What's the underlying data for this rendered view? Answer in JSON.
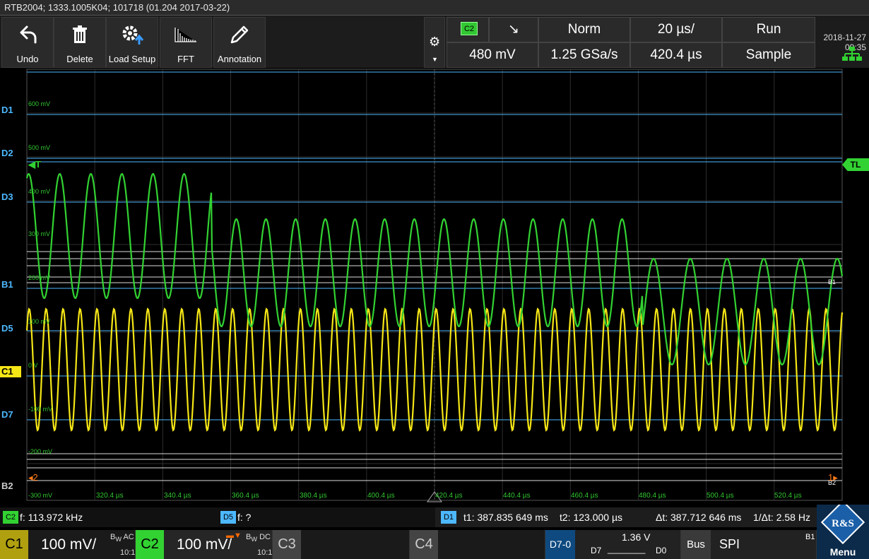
{
  "window": {
    "title": "RTB2004; 1333.1005K04; 101718 (01.204 2017-03-22)"
  },
  "toolbar": {
    "undo": "Undo",
    "delete": "Delete",
    "load_setup": "Load Setup",
    "fft": "FFT",
    "annotation": "Annotation"
  },
  "trigger": {
    "channel": "C2",
    "slope_symbol": "↘",
    "mode": "Norm",
    "level": "480 mV"
  },
  "timebase": {
    "scale": "20 µs/",
    "sample_rate": "1.25 GSa/s",
    "position": "420.4 µs"
  },
  "acquisition": {
    "state": "Run",
    "mode": "Sample"
  },
  "datetime": {
    "date": "2018-11-27",
    "time": "09:35"
  },
  "grid": {
    "left_tags": [
      "D1",
      "D2",
      "D3",
      "B1",
      "D5",
      "C1",
      "D7",
      "B2"
    ],
    "y_labels": [
      "600 mV",
      "500 mV",
      "400 mV",
      "300 mV",
      "200 mV",
      "100 mV",
      "0 V",
      "-100 mV",
      "-200 mV",
      "-300 mV"
    ],
    "x_labels": [
      "320.4 µs",
      "340.4 µs",
      "360.4 µs",
      "380.4 µs",
      "400.4 µs",
      "420.4 µs",
      "440.4 µs",
      "460.4 µs",
      "480.4 µs",
      "500.4 µs",
      "520.4 µs"
    ],
    "trigger_marker": "T",
    "trigger_level_marker": "TL",
    "bus_marker_right": "B1",
    "bus_marker_right2": "B2",
    "cursor_left": "2",
    "cursor_right": "1"
  },
  "measurements": {
    "c2_badge": "C2",
    "c2_freq": "f: 113.972 kHz",
    "d5_badge": "D5",
    "d5_freq": "f: ?",
    "d1_badge": "D1",
    "t1": "t1: 387.835 649 ms",
    "t2": "t2: 123.000 µs",
    "dt": "Δt: 387.712 646 ms",
    "inv_dt": "1/Δt: 2.58 Hz"
  },
  "channels": {
    "c1": {
      "name": "C1",
      "scale": "100 mV/",
      "coupling": "AC",
      "probe": "10:1"
    },
    "c2": {
      "name": "C2",
      "scale": "100 mV/",
      "coupling": "DC",
      "probe": "10:1"
    },
    "c3": {
      "name": "C3"
    },
    "c4": {
      "name": "C4"
    },
    "logic": {
      "name": "D7-0",
      "threshold": "1.36 V",
      "msb": "D7",
      "lsb": "D0",
      "pattern": "________"
    },
    "bus": {
      "name": "Bus",
      "protocol": "SPI",
      "id": "B1"
    }
  },
  "menu": {
    "label": "Menu"
  },
  "colors": {
    "c1": "#f5e616",
    "c2": "#32d232",
    "digital": "#4db8ff",
    "accent": "#1a5fa8"
  }
}
